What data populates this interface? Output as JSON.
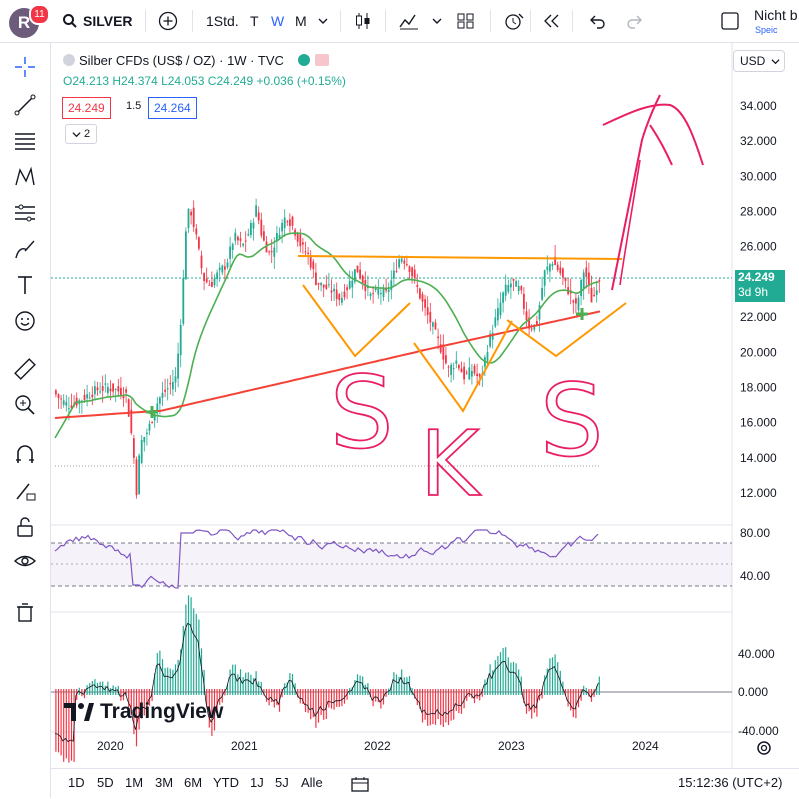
{
  "header": {
    "avatar_letter": "R",
    "notifications": "11",
    "symbol": "SILVER",
    "intervals": [
      "1Std.",
      "T",
      "W",
      "M"
    ],
    "active_interval": "W",
    "truncated_right": "Nicht b",
    "truncated_sub": "Speic"
  },
  "legend": {
    "title": "Silber CFDs (US$ / OZ) · 1W · TVC",
    "ohlc": "O24.213 H24.374 L24.053 C24.249 +0.036 (+0.15%)",
    "bid": "24.249",
    "spread": "1.5",
    "ask": "24.264",
    "indicators_collapsed": "2"
  },
  "price_scale": {
    "currency": "USD",
    "last_price": "24.249",
    "countdown": "3d 9h",
    "ticks": [
      "34.000",
      "32.000",
      "30.000",
      "28.000",
      "26.000",
      "24.000",
      "22.000",
      "20.000",
      "18.000",
      "16.000",
      "14.000",
      "12.000"
    ]
  },
  "rsi_scale": {
    "ticks": [
      "80.00",
      "40.00"
    ]
  },
  "osc_scale": {
    "ticks": [
      "40.000",
      "0.000",
      "-40.000"
    ]
  },
  "time_axis": {
    "labels": [
      "2020",
      "2021",
      "2022",
      "2023",
      "2024"
    ]
  },
  "annotations": {
    "pattern_letters": [
      "S",
      "K",
      "S"
    ]
  },
  "logo_text": "TradingView",
  "bottom": {
    "ranges": [
      "1D",
      "5D",
      "1M",
      "3M",
      "6M",
      "YTD",
      "1J",
      "5J",
      "Alle"
    ],
    "clock": "15:12:36 (UTC+2)"
  },
  "colors": {
    "up": "#22ab94",
    "down": "#f23645",
    "ma_fast": "#4caf50",
    "ma_slow": "#f44336",
    "neckline": "#ff9800",
    "rsi": "#7e57c2",
    "annotation": "#e91e63"
  }
}
